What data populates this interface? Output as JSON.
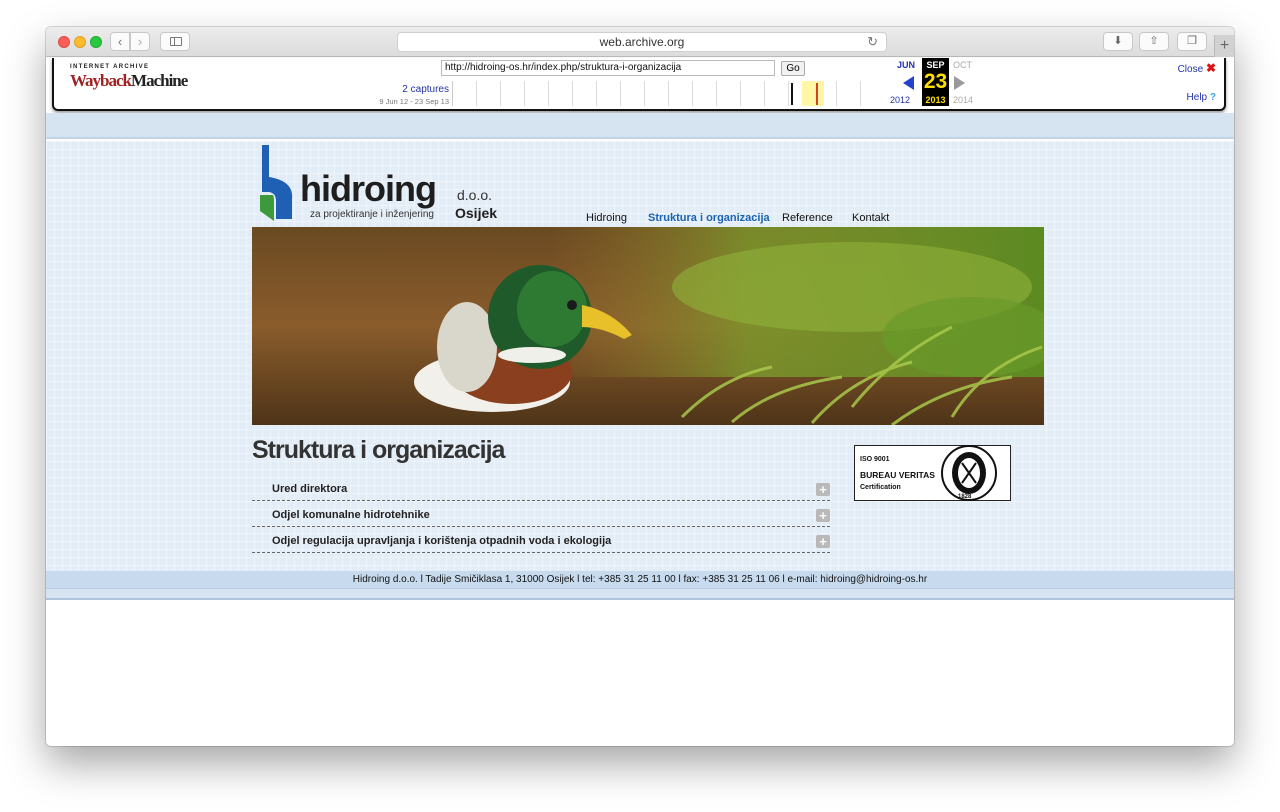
{
  "browser": {
    "address": "web.archive.org"
  },
  "wayback": {
    "url_value": "http://hidroing-os.hr/index.php/struktura-i-organizacija",
    "go_label": "Go",
    "captures": "2 captures",
    "range": "9 Jun 12 - 23 Sep 13",
    "months": {
      "prev": "JUN",
      "current": "SEP",
      "next": "OCT"
    },
    "day": "23",
    "years": {
      "prev": "2012",
      "current": "2013",
      "next": "2014"
    },
    "close_label": "Close",
    "help_label": "Help"
  },
  "site": {
    "logo": {
      "name": "hidroing",
      "suffix": "d.o.o.",
      "tagline": "za projektiranje i inženjering",
      "city": "Osijek"
    },
    "menu": [
      "Hidroing",
      "Struktura i organizacija",
      "Reference",
      "Kontakt"
    ],
    "active_menu": "Struktura i organizacija",
    "heading": "Struktura i organizacija",
    "sections": [
      "Ured direktora",
      "Odjel komunalne hidrotehnike",
      "Odjel regulacija upravljanja i korištenja otpadnih voda i ekologija"
    ],
    "certificate": {
      "iso": "ISO 9001",
      "company": "BUREAU VERITAS",
      "sub": "Certification",
      "year": "1828"
    },
    "footer": "Hidroing d.o.o. l Tadije Smičiklasa 1, 31000 Osijek l tel: +385 31 25 11 00 l fax: +385 31 25 11 06 l e-mail: hidroing@hidroing-os.hr"
  },
  "colors": {
    "page_bg": "#e3edf8",
    "active_menu": "#1a63b3",
    "logo_blue": "#1f5fb4",
    "logo_green": "#3c9a3a"
  }
}
